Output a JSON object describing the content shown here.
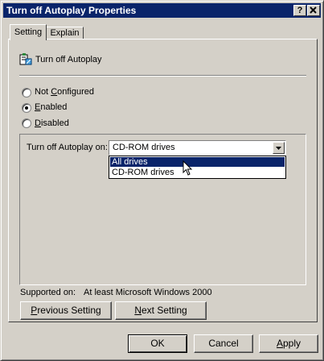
{
  "window": {
    "title": "Turn off Autoplay Properties",
    "help_button": "?",
    "close_button": "X"
  },
  "tabs": [
    {
      "label": "Setting"
    },
    {
      "label": "Explain"
    }
  ],
  "policy": {
    "icon": "policy-setting-icon",
    "name": "Turn off Autoplay"
  },
  "options": [
    {
      "label": "Not Configured",
      "selected": false
    },
    {
      "label": "Enabled",
      "selected": true
    },
    {
      "label": "Disabled",
      "selected": false
    }
  ],
  "autoplay": {
    "label": "Turn off Autoplay on:",
    "selected_value": "CD-ROM drives",
    "dropdown_options": [
      "All drives",
      "CD-ROM drives"
    ],
    "highlighted_option": "All drives"
  },
  "supported": {
    "label": "Supported on:",
    "value": "At least Microsoft Windows 2000"
  },
  "nav": {
    "previous": "Previous Setting",
    "next": "Next Setting"
  },
  "buttons": {
    "ok": "OK",
    "cancel": "Cancel",
    "apply": "Apply"
  },
  "colors": {
    "titlebar": "#0a246a",
    "face": "#d4d0c8",
    "highlight": "#0a246a"
  }
}
